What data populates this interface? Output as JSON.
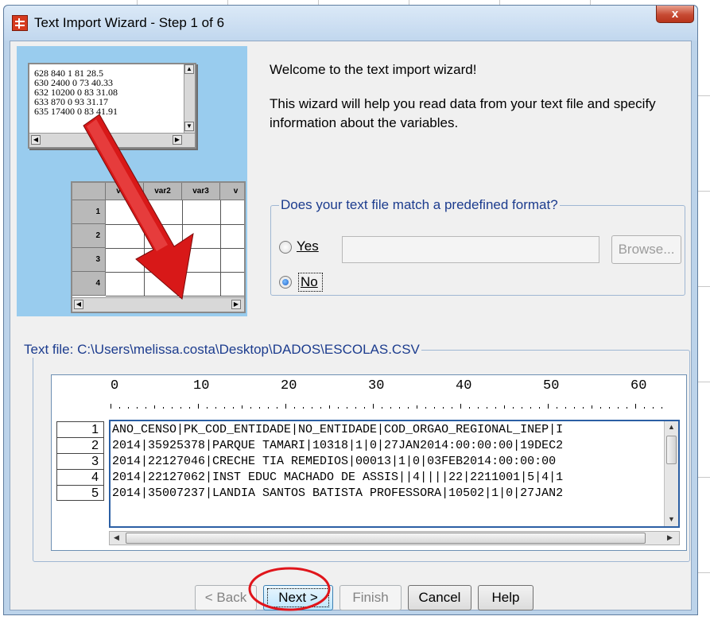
{
  "window": {
    "title": "Text Import Wizard - Step 1 of 6",
    "close_glyph": "x"
  },
  "illustration": {
    "text_lines": [
      "628 840 1 81 28.5",
      "630 2400 0 73 40.33",
      "632 10200 0 83 31.08",
      "633 870 0 93 31.17",
      "635 17400 0 83 41.91"
    ],
    "grid_headers": [
      "var1",
      "var2",
      "var3",
      "v"
    ],
    "grid_rows": [
      "1",
      "2",
      "3",
      "4"
    ]
  },
  "welcome": {
    "heading": "Welcome to the text import wizard!",
    "description": "This wizard will help you read data from your text file and specify information about the variables."
  },
  "format": {
    "legend": "Does your text file match a predefined format?",
    "yes_label": "Yes",
    "no_label": "No",
    "selected": "No",
    "path_value": "",
    "browse_label": "Browse..."
  },
  "text_file": {
    "legend": "Text file:  C:\\Users\\melissa.costa\\Desktop\\DADOS\\ESCOLAS.CSV",
    "ruler_numbers": [
      "0",
      "10",
      "20",
      "30",
      "40",
      "50",
      "60"
    ],
    "row_numbers": [
      "1",
      "2",
      "3",
      "4",
      "5"
    ],
    "lines": [
      "ANO_CENSO|PK_COD_ENTIDADE|NO_ENTIDADE|COD_ORGAO_REGIONAL_INEP|I",
      "2014|35925378|PARQUE TAMARI|10318|1|0|27JAN2014:00:00:00|19DEC2",
      "2014|22127046|CRECHE TIA REMEDIOS|00013|1|0|03FEB2014:00:00:00 ",
      "2014|22127062|INST EDUC MACHADO DE ASSIS||4||||22|2211001|5|4|1",
      "2014|35007237|LANDIA SANTOS BATISTA PROFESSORA|10502|1|0|27JAN2"
    ]
  },
  "buttons": {
    "back": "< Back",
    "next": "Next >",
    "finish": "Finish",
    "cancel": "Cancel",
    "help": "Help"
  },
  "colors": {
    "accent": "#1c3c8e",
    "annotation": "#e0151b",
    "illustration_bg": "#99ccee",
    "arrow": "#d81818"
  }
}
